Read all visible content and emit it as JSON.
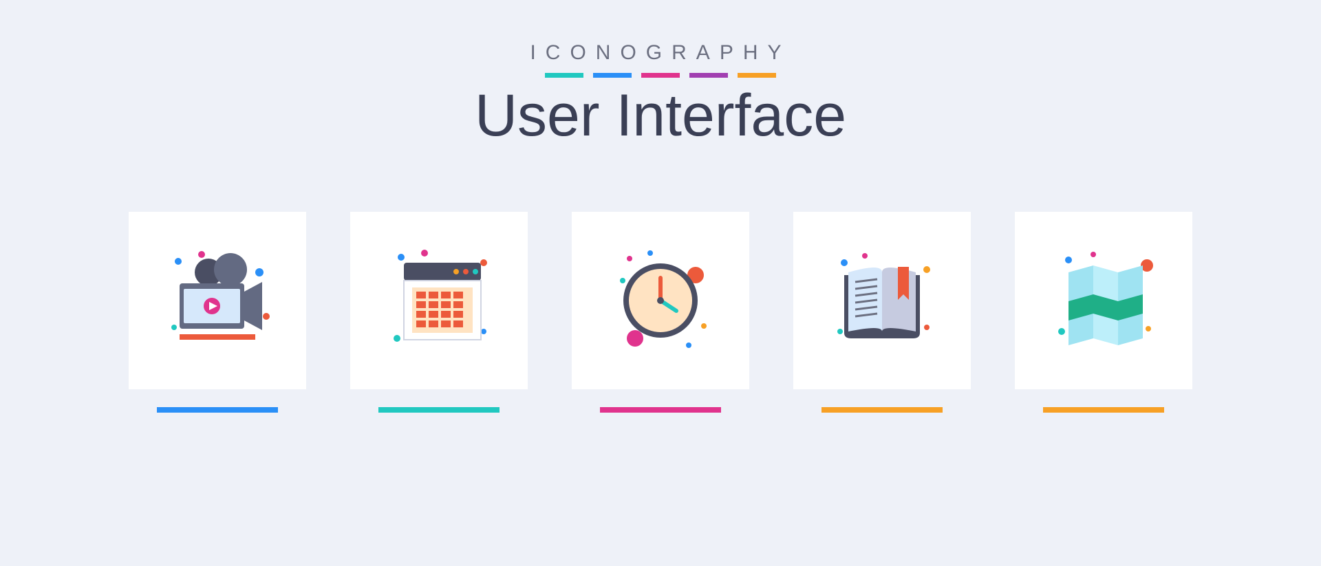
{
  "header": {
    "eyebrow": "ICONOGRAPHY",
    "title": "User Interface"
  },
  "accentColors": [
    "#20c8c0",
    "#2a8ff7",
    "#e0338d",
    "#a13fb1",
    "#f7a025"
  ],
  "icons": [
    {
      "name": "video-camera-icon",
      "underline": "c-blue"
    },
    {
      "name": "calendar-window-icon",
      "underline": "c-teal"
    },
    {
      "name": "clock-icon",
      "underline": "c-pink"
    },
    {
      "name": "open-book-icon",
      "underline": "c-orange"
    },
    {
      "name": "map-icon",
      "underline": "c-orange"
    }
  ]
}
